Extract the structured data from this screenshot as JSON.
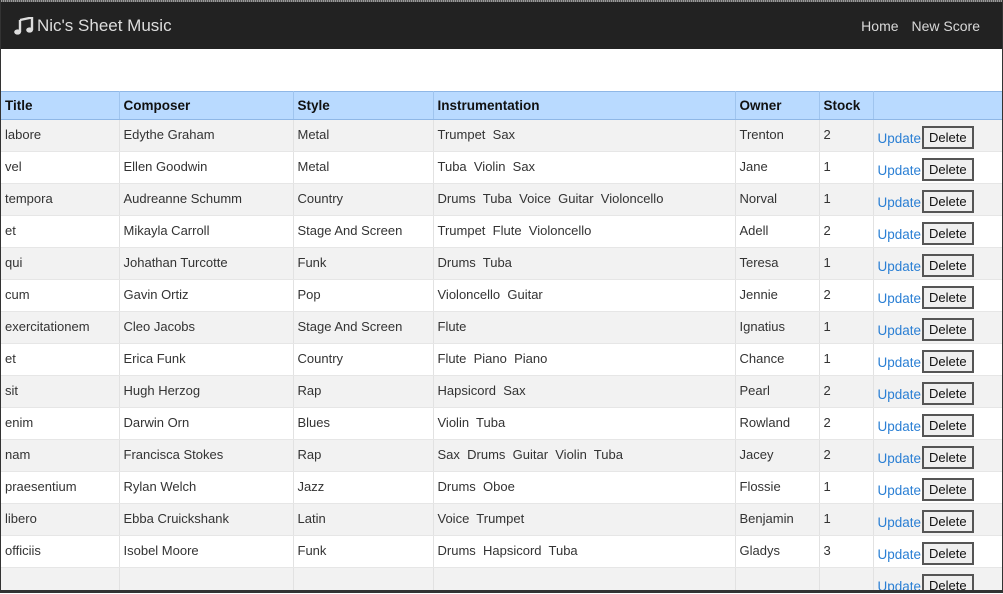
{
  "navbar": {
    "brand": "Nic's Sheet Music",
    "links": [
      "Home",
      "New Score"
    ]
  },
  "table": {
    "columns": [
      "Title",
      "Composer",
      "Style",
      "Instrumentation",
      "Owner",
      "Stock",
      ""
    ],
    "update_label": "Update",
    "delete_label": "Delete",
    "rows": [
      {
        "title": "labore",
        "composer": "Edythe Graham",
        "style": "Metal",
        "instrumentation": "Trumpet  Sax",
        "owner": "Trenton",
        "stock": "2"
      },
      {
        "title": "vel",
        "composer": "Ellen Goodwin",
        "style": "Metal",
        "instrumentation": "Tuba  Violin  Sax",
        "owner": "Jane",
        "stock": "1"
      },
      {
        "title": "tempora",
        "composer": "Audreanne Schumm",
        "style": "Country",
        "instrumentation": "Drums  Tuba  Voice  Guitar  Violoncello",
        "owner": "Norval",
        "stock": "1"
      },
      {
        "title": "et",
        "composer": "Mikayla Carroll",
        "style": "Stage And Screen",
        "instrumentation": "Trumpet  Flute  Violoncello",
        "owner": "Adell",
        "stock": "2"
      },
      {
        "title": "qui",
        "composer": "Johathan Turcotte",
        "style": "Funk",
        "instrumentation": "Drums  Tuba",
        "owner": "Teresa",
        "stock": "1"
      },
      {
        "title": "cum",
        "composer": "Gavin Ortiz",
        "style": "Pop",
        "instrumentation": "Violoncello  Guitar",
        "owner": "Jennie",
        "stock": "2"
      },
      {
        "title": "exercitationem",
        "composer": "Cleo Jacobs",
        "style": "Stage And Screen",
        "instrumentation": "Flute",
        "owner": "Ignatius",
        "stock": "1"
      },
      {
        "title": "et",
        "composer": "Erica Funk",
        "style": "Country",
        "instrumentation": "Flute  Piano  Piano",
        "owner": "Chance",
        "stock": "1"
      },
      {
        "title": "sit",
        "composer": "Hugh Herzog",
        "style": "Rap",
        "instrumentation": "Hapsicord  Sax",
        "owner": "Pearl",
        "stock": "2"
      },
      {
        "title": "enim",
        "composer": "Darwin Orn",
        "style": "Blues",
        "instrumentation": "Violin  Tuba",
        "owner": "Rowland",
        "stock": "2"
      },
      {
        "title": "nam",
        "composer": "Francisca Stokes",
        "style": "Rap",
        "instrumentation": "Sax  Drums  Guitar  Violin  Tuba",
        "owner": "Jacey",
        "stock": "2"
      },
      {
        "title": "praesentium",
        "composer": "Rylan Welch",
        "style": "Jazz",
        "instrumentation": "Drums  Oboe",
        "owner": "Flossie",
        "stock": "1"
      },
      {
        "title": "libero",
        "composer": "Ebba Cruickshank",
        "style": "Latin",
        "instrumentation": "Voice  Trumpet",
        "owner": "Benjamin",
        "stock": "1"
      },
      {
        "title": "officiis",
        "composer": "Isobel Moore",
        "style": "Funk",
        "instrumentation": "Drums  Hapsicord  Tuba",
        "owner": "Gladys",
        "stock": "3"
      },
      {
        "title": "",
        "composer": "",
        "style": "",
        "instrumentation": "",
        "owner": "",
        "stock": ""
      }
    ]
  },
  "colors": {
    "navbar_bg": "#222222",
    "header_bg": "#b9daff",
    "link": "#2a7fd4"
  }
}
